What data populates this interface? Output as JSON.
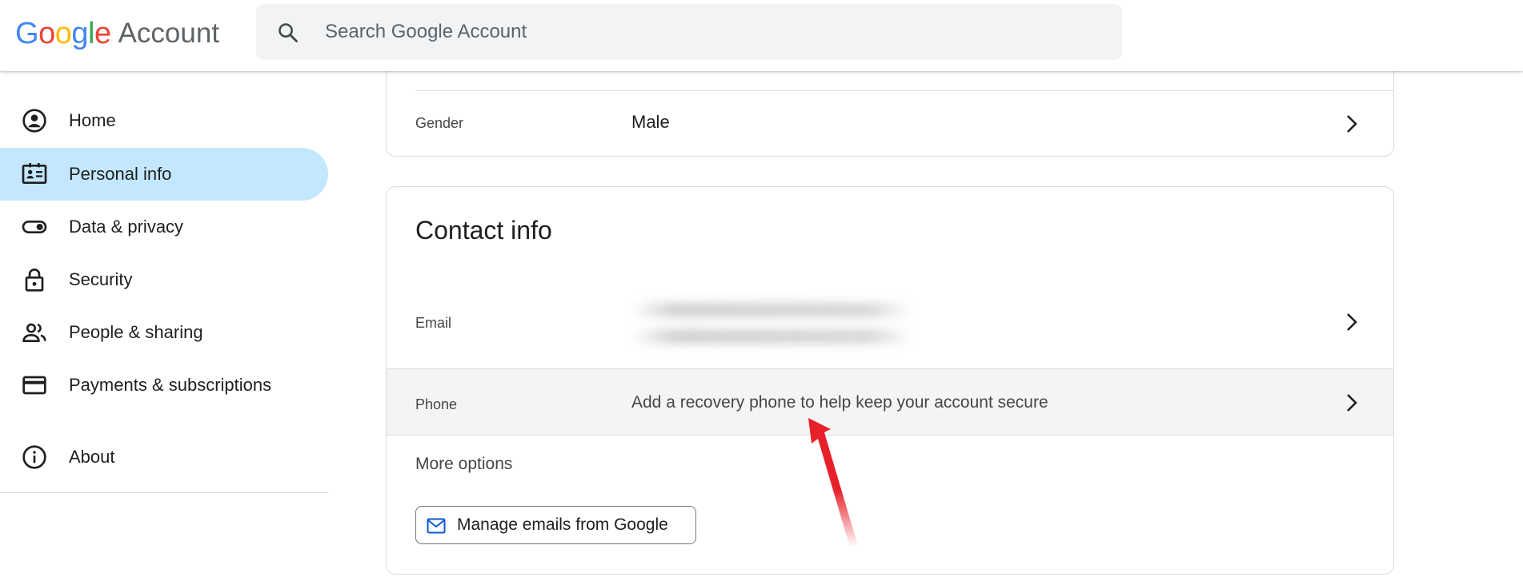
{
  "header": {
    "logo_letters": [
      "G",
      "o",
      "o",
      "g",
      "l",
      "e"
    ],
    "logo_colors": [
      "#4285F4",
      "#EA4335",
      "#FBBC05",
      "#4285F4",
      "#34A853",
      "#EA4335"
    ],
    "product": "Account",
    "search_placeholder": "Search Google Account"
  },
  "sidebar": {
    "items": [
      {
        "label": "Home",
        "icon": "account-circle-icon"
      },
      {
        "label": "Personal info",
        "icon": "id-card-icon",
        "active": true
      },
      {
        "label": "Data & privacy",
        "icon": "toggle-icon"
      },
      {
        "label": "Security",
        "icon": "lock-icon"
      },
      {
        "label": "People & sharing",
        "icon": "people-icon"
      },
      {
        "label": "Payments & subscriptions",
        "icon": "credit-card-icon"
      },
      {
        "label": "About",
        "icon": "info-icon"
      }
    ],
    "active_color": "#c2e7ff"
  },
  "basic_info": {
    "gender_label": "Gender",
    "gender_value": "Male"
  },
  "contact_info": {
    "title": "Contact info",
    "email_label": "Email",
    "phone_label": "Phone",
    "phone_value": "Add a recovery phone to help keep your account secure",
    "more_options": "More options",
    "manage_emails_button": "Manage emails from Google"
  },
  "annotation": {
    "arrow_color": "#e8202a"
  }
}
